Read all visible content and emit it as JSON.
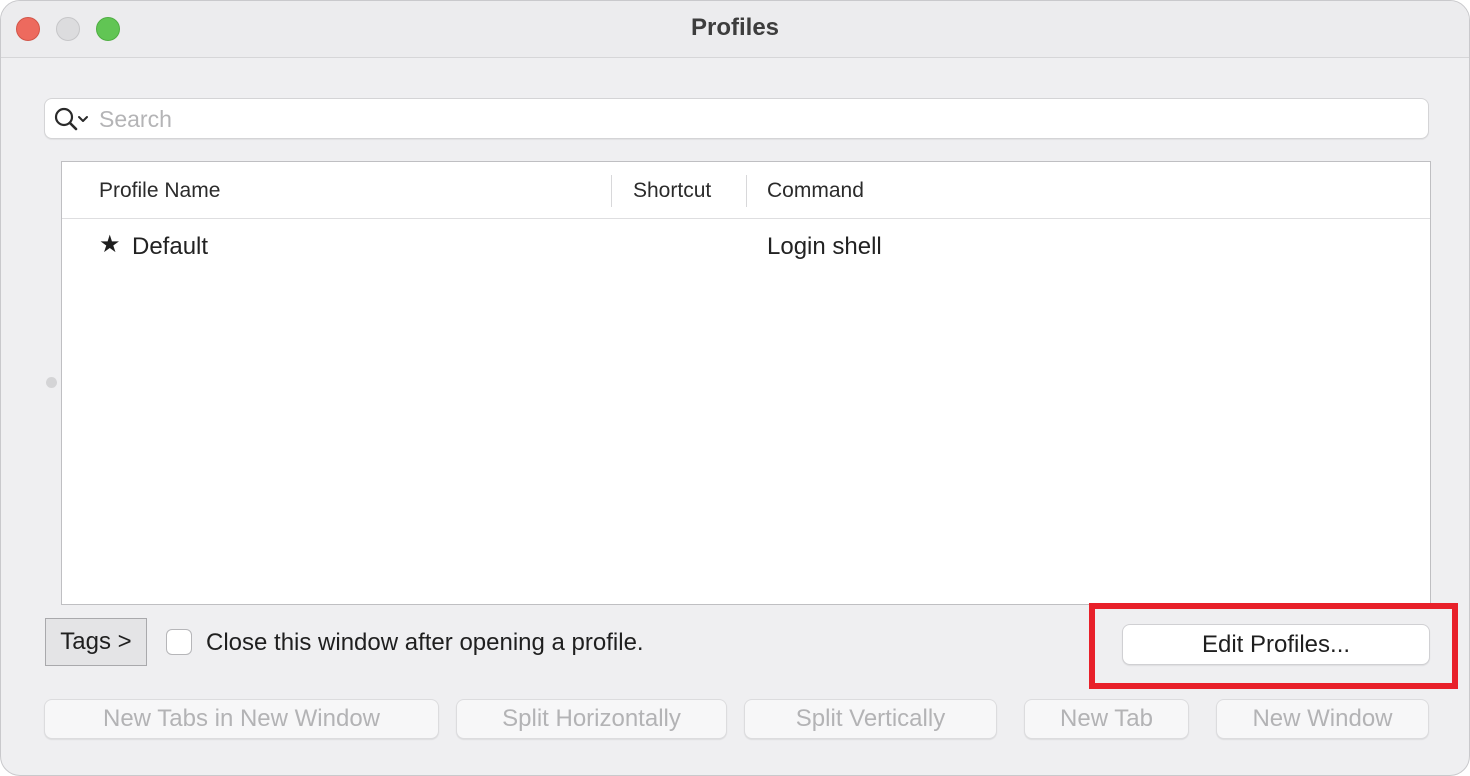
{
  "window": {
    "title": "Profiles",
    "colors": {
      "close": "#ed6a5e",
      "minimize": "#dcdcde",
      "maximize": "#61c554",
      "highlight": "#e8202a"
    }
  },
  "search": {
    "placeholder": "Search",
    "value": ""
  },
  "table": {
    "columns": [
      "Profile Name",
      "Shortcut",
      "Command"
    ],
    "rows": [
      {
        "name": "Default",
        "is_default": true,
        "shortcut": "",
        "command": "Login shell"
      }
    ]
  },
  "footer": {
    "tags_label": "Tags >",
    "close_checkbox_label": "Close this window after opening a profile.",
    "close_checkbox_checked": false,
    "edit_profiles_label": "Edit Profiles..."
  },
  "actions": {
    "new_tabs_in_new_window": "New Tabs in New Window",
    "split_horizontally": "Split Horizontally",
    "split_vertically": "Split Vertically",
    "new_tab": "New Tab",
    "new_window": "New Window"
  }
}
